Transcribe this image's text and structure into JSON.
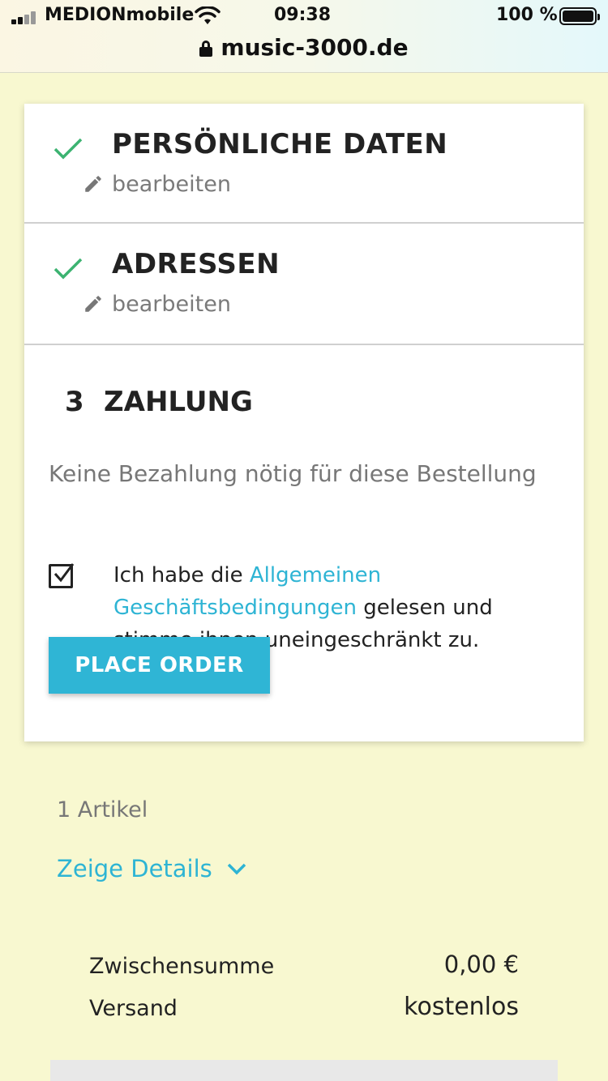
{
  "status_bar": {
    "carrier": "MEDIONmobile",
    "time": "09:38",
    "battery": "100 %"
  },
  "browser": {
    "url": "music-3000.de"
  },
  "checkout": {
    "steps": [
      {
        "title": "PERSÖNLICHE DATEN",
        "edit_label": "bearbeiten",
        "status": "complete"
      },
      {
        "title": "ADRESSEN",
        "edit_label": "bearbeiten",
        "status": "complete"
      }
    ],
    "payment": {
      "number": "3",
      "title": "ZAHLUNG",
      "note": "Keine Bezahlung nötig für diese Bestellung"
    },
    "terms": {
      "checked": true,
      "text_before": "Ich habe die ",
      "link_text": "Allgemeinen Geschäftsbedingungen",
      "text_after": " gelesen und stimme ihnen uneingeschränkt zu."
    },
    "place_order_label": "PLACE ORDER"
  },
  "summary": {
    "items_count": "1 Artikel",
    "details_label": "Zeige Details",
    "subtotal_label": "Zwischensumme",
    "subtotal_value": "0,00 €",
    "shipping_label": "Versand",
    "shipping_value": "kostenlos"
  },
  "colors": {
    "accent": "#2fb5d5",
    "check": "#3cb371",
    "background": "#f8f8d0"
  }
}
